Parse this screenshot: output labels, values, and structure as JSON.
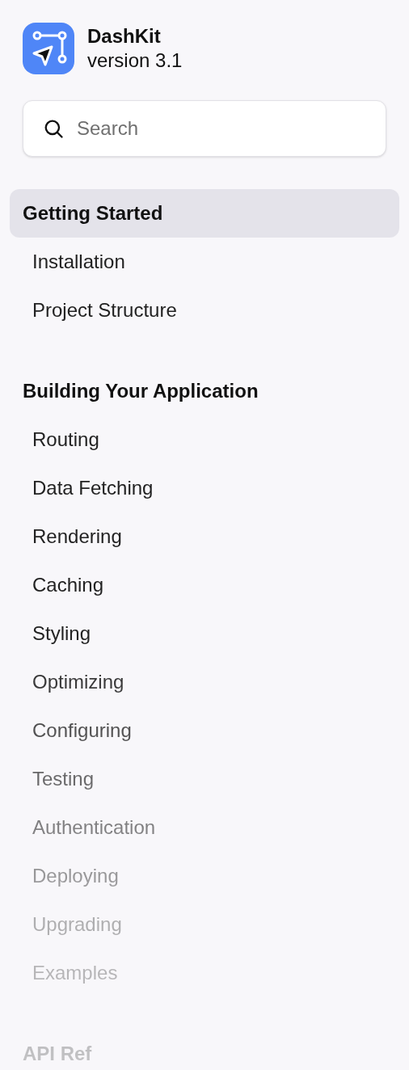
{
  "app": {
    "name": "DashKit",
    "version": "version 3.1"
  },
  "search": {
    "placeholder": "Search"
  },
  "sections": [
    {
      "title": "Getting Started",
      "selected": true,
      "items": [
        "Installation",
        "Project Structure"
      ]
    },
    {
      "title": "Building Your Application",
      "selected": false,
      "items": [
        "Routing",
        "Data Fetching",
        "Rendering",
        "Caching",
        "Styling",
        "Optimizing",
        "Configuring",
        "Testing",
        "Authentication",
        "Deploying",
        "Upgrading",
        "Examples"
      ]
    },
    {
      "title": "API Ref"
    }
  ]
}
